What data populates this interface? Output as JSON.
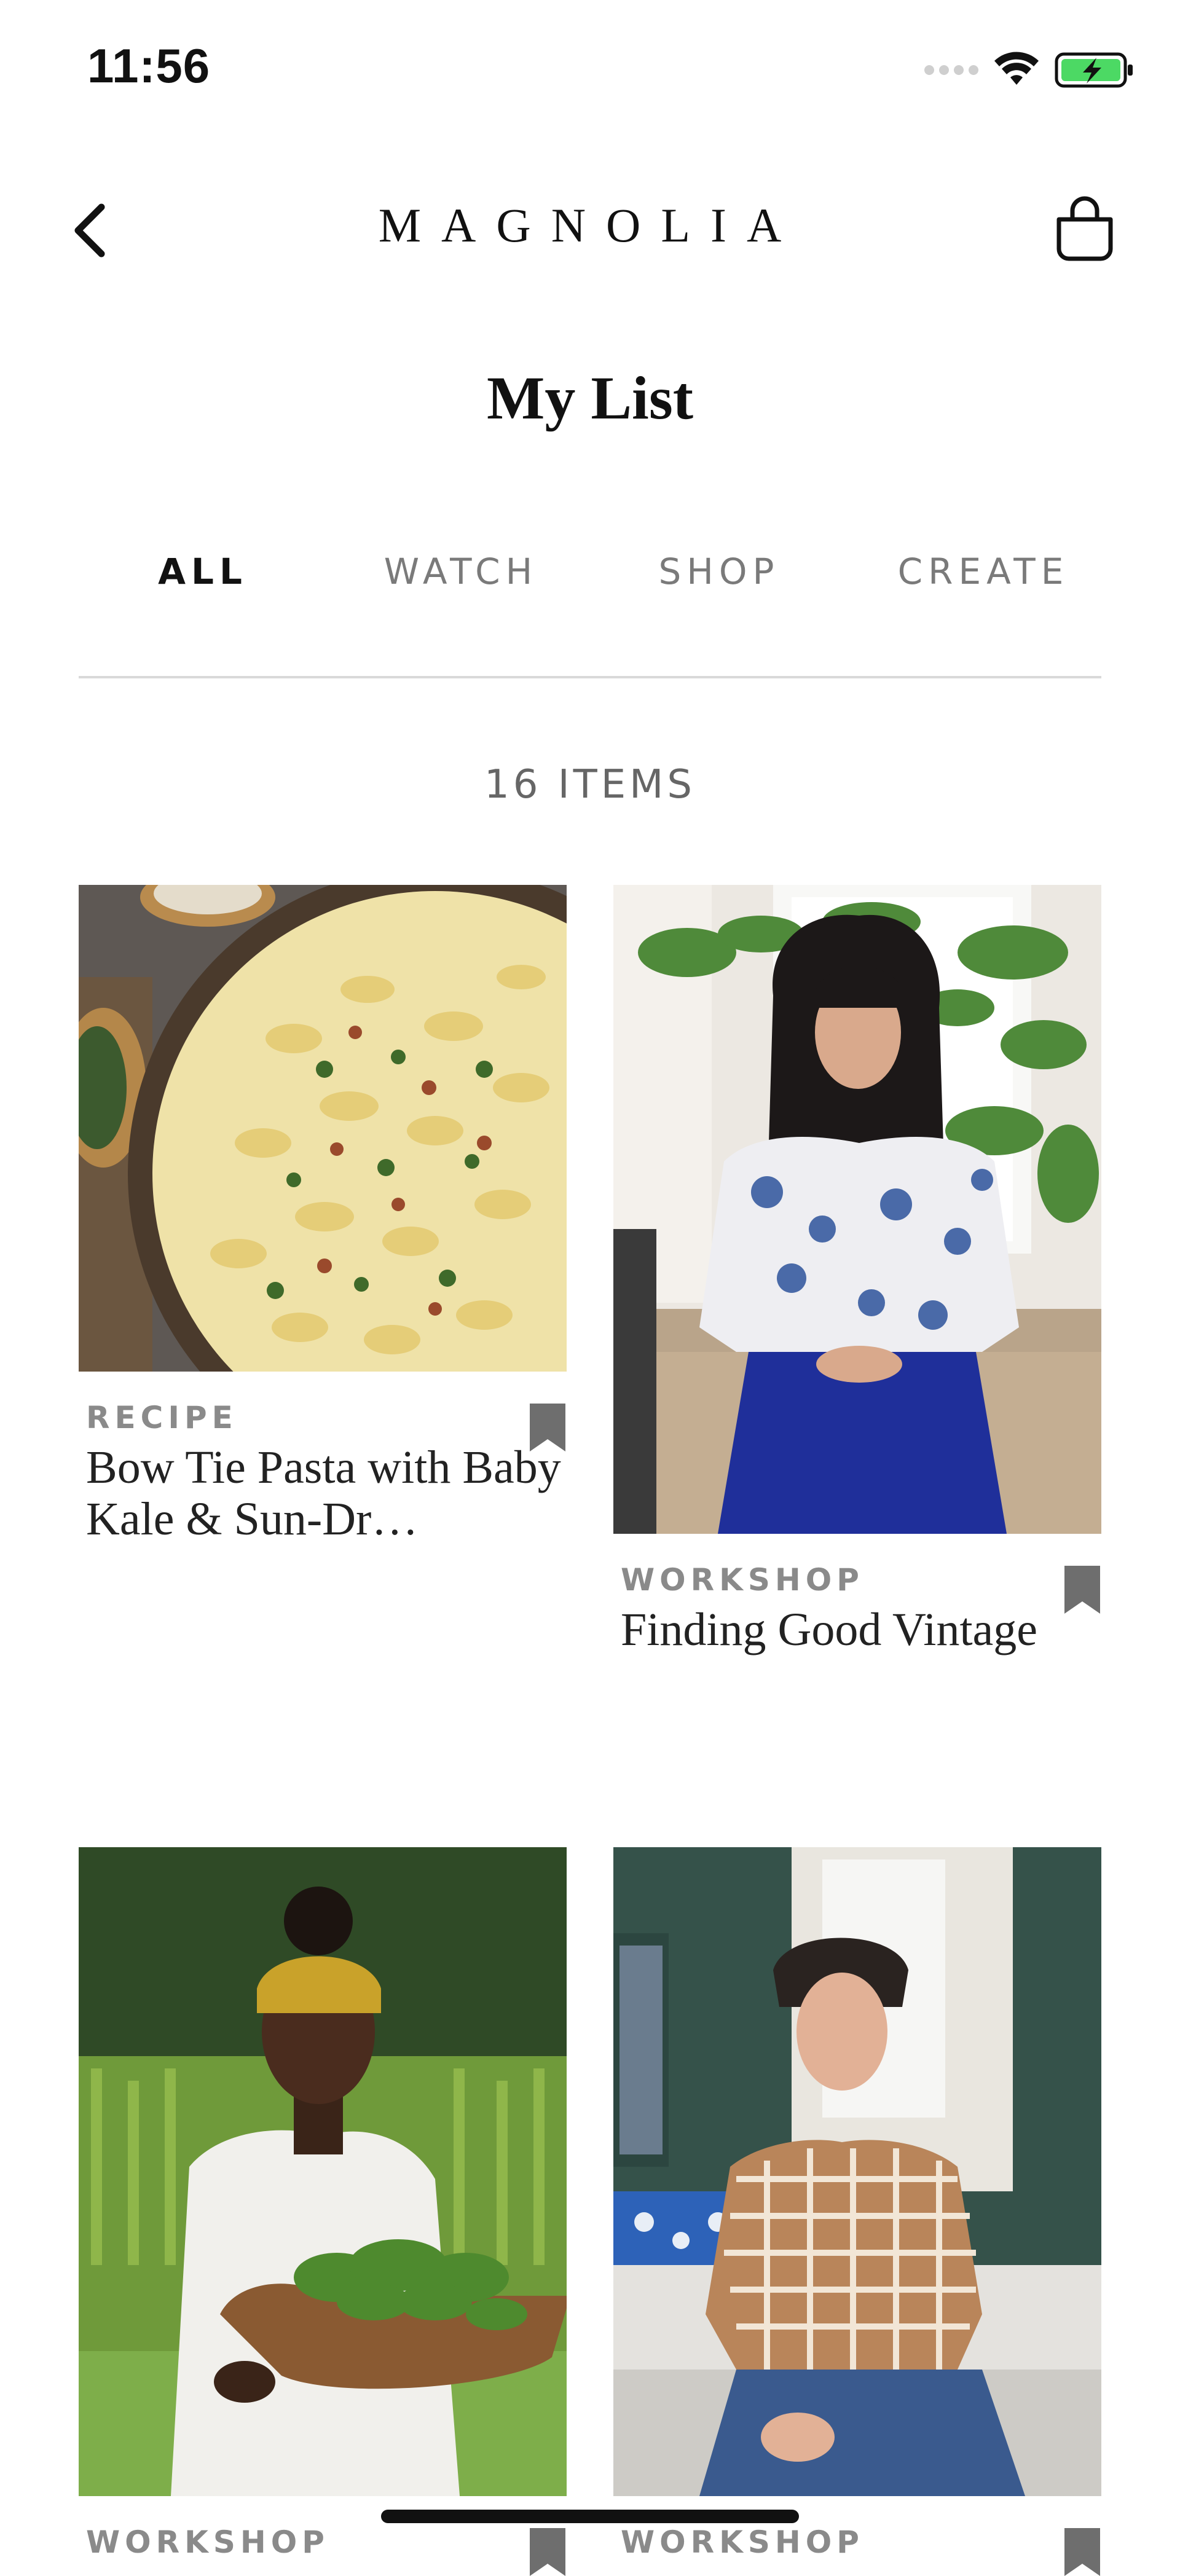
{
  "status_bar": {
    "time": "11:56"
  },
  "nav": {
    "brand": "MAGNOLIA"
  },
  "page": {
    "title": "My List",
    "item_count": "16 ITEMS"
  },
  "tabs": [
    "ALL",
    "WATCH",
    "SHOP",
    "CREATE"
  ],
  "active_tab": "ALL",
  "cards": [
    {
      "category": "RECIPE",
      "title": "Bow Tie Pasta with Baby Kale & Sun-Dr…",
      "bookmarked": true
    },
    {
      "category": "WORKSHOP",
      "title": "Finding Good Vintage",
      "bookmarked": true
    },
    {
      "category": "WORKSHOP",
      "title": "",
      "bookmarked": true
    },
    {
      "category": "WORKSHOP",
      "title": "",
      "bookmarked": true
    }
  ],
  "colors": {
    "accent": "#111111",
    "muted": "#7a7a7a",
    "battery": "#4cd964",
    "bookmark": "#6e6e6e"
  }
}
